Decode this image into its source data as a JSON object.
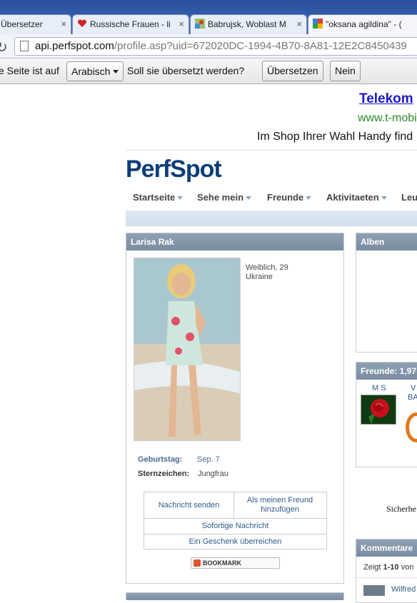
{
  "tabs": [
    {
      "title": "Übersetzer",
      "icon": "translate-icon"
    },
    {
      "title": "Russische Frauen - li",
      "icon": "heart-icon"
    },
    {
      "title": "Babrujsk, Woblast M",
      "icon": "maps-icon"
    },
    {
      "title": "\"oksana agildina\" - (",
      "icon": "google-icon"
    }
  ],
  "close_glyph": "×",
  "address": {
    "host": "api.perfspot.com",
    "path": "/profile.asp?uid=672020DC-1994-4B70-8A81-12E2C8450439"
  },
  "translate_bar": {
    "prefix": "e Seite ist auf",
    "language": "Arabisch",
    "question": "Soll sie übersetzt werden?",
    "translate_button": "Übersetzen",
    "no_button": "Nein"
  },
  "ad": {
    "title": "Telekom",
    "url": "www.t-mobi",
    "text": "Im Shop Ihrer Wahl Handy find"
  },
  "logo": "PerfSpot",
  "nav": [
    "Startseite",
    "Sehe mein",
    "Freunde",
    "Aktivitaeten",
    "Leu"
  ],
  "profile": {
    "name": "Larisa Rak",
    "gender_age": "Weiblich, 29",
    "country": "Ukraine",
    "birthday_label": "Geburtstag:",
    "birthday": "Sep. 7",
    "zodiac_label": "Sternzeichen:",
    "zodiac": "Jungfrau"
  },
  "actions": {
    "message": "Nachricht senden",
    "add_friend": "Als meinen Freund hinzufügen",
    "instant": "Sofortige Nachricht",
    "gift": "Ein Geschenk überreichen"
  },
  "bookmark": "BOOKMARK",
  "albums": {
    "title": "Alben"
  },
  "friends": {
    "title": "Freunde: 1,97",
    "items": [
      {
        "name": "M S"
      },
      {
        "name": "V",
        "name2": "BA"
      }
    ]
  },
  "sicherheit": "Sicherhe",
  "comments": {
    "title": "Kommentare",
    "count_prefix": "Zeigt",
    "count_range": "1-10",
    "count_suffix": "von",
    "first_author": "Wilfred"
  }
}
